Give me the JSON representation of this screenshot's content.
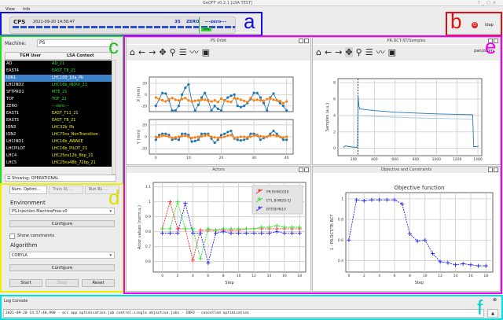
{
  "window": {
    "title": "GeOFF v0.2.1 [LSA TEST]",
    "controls": [
      "?",
      "_",
      "□",
      "×"
    ]
  },
  "menu": [
    "View",
    "Info"
  ],
  "timing": {
    "machine": "CPS",
    "timestamp": "2021-09-20 14:56:47",
    "cycle_number": "35",
    "user": "ZERO",
    "context": "---zero---",
    "indicator": "zero"
  },
  "login": {
    "label": "ldap",
    "icon": "power-icon",
    "color": "#e02020"
  },
  "annotations": {
    "a": "a",
    "b": "b",
    "c": "c",
    "d": "d",
    "e": "e",
    "f": "f"
  },
  "annotation_colors": {
    "a": "#1010e0",
    "b": "#e01010",
    "c": "#20e020",
    "d": "#f0f000",
    "e": "#f000f0",
    "f": "#00e0e0"
  },
  "selector": {
    "machine_label": "Machine:",
    "machine_value": "PS",
    "columns": [
      "TGM User",
      "LSA Context"
    ],
    "rows": [
      {
        "user": "AD",
        "context": "AD_21",
        "color": "#30e030"
      },
      {
        "user": "EAST4",
        "context": "EAST_T8_21",
        "color": "#30e030"
      },
      {
        "user": "ION1",
        "context": "LHC100_10a_Pb",
        "color": "#ffffff",
        "selected": true
      },
      {
        "user": "LHCIND2",
        "context": "LHC16b_INDIV_21",
        "color": "#30e030"
      },
      {
        "user": "SFTPRO1",
        "context": "MTE_21",
        "color": "#30e030"
      },
      {
        "user": "TOF",
        "context": "TOF_21",
        "color": "#30e030"
      },
      {
        "user": "ZERO",
        "context": "---zero---",
        "color": "#30e030"
      },
      {
        "user": "EAST1",
        "context": "EAST_T11_21",
        "color": "#f0f020"
      },
      {
        "user": "EAST3",
        "context": "EAST_T8_21",
        "color": "#f0f020"
      },
      {
        "user": "ION3",
        "context": "LHC32b_Pb",
        "color": "#f0f020"
      },
      {
        "user": "ION2",
        "context": "LHC75ns_NonTransition",
        "color": "#f0f020"
      },
      {
        "user": "LHCIND1",
        "context": "LHC16b_AWAKE",
        "color": "#f0f020"
      },
      {
        "user": "LHCPILOT",
        "context": "LHC16b_PILOT_21",
        "color": "#f0f020"
      },
      {
        "user": "LHC4",
        "context": "LHC25ns12b_8bp_21",
        "color": "#f0f020"
      },
      {
        "user": "LHC5",
        "context": "LHC25ns48b_72bp_21",
        "color": "#f0f020"
      }
    ],
    "showing": "Showing: OPERATIONAL"
  },
  "controls": {
    "tabs": [
      "Num. Optimi...",
      "Train RL ...",
      "Run RL ..."
    ],
    "environment_label": "Environment",
    "environment_value": "PS-Injection-MachineFree-v0",
    "configure": "Configure",
    "show_constraints": "Show constraints",
    "algorithm_label": "Algorithm",
    "algorithm_value": "COBYLA",
    "start": "Start",
    "stop": "Stop",
    "reset": "Reset"
  },
  "panels": {
    "orbit": "PS Orbit",
    "samples": "PR.DCT-ST/Samples",
    "actors": "Actors",
    "objective": "Objective and Constraints",
    "pan_zoom": "pan/zoom"
  },
  "log": {
    "title": "Log Console",
    "line": "2021-09-20 14:57:48,990 - acc app optimisation.job control.single objective.jobs - INFO - cancelled optimization"
  },
  "chart_data": [
    {
      "type": "line",
      "title": "",
      "xlabel": "",
      "ylabel": "X (mm)",
      "xlim": [
        -2,
        42
      ],
      "ylim": [
        -30,
        31
      ],
      "yticks": [
        20,
        0,
        -20
      ],
      "xticks": [
        0,
        10,
        20,
        30,
        40
      ],
      "grid": true,
      "x": [
        0,
        1,
        2,
        3,
        4,
        5,
        6,
        7,
        8,
        9,
        10,
        11,
        12,
        13,
        14,
        15,
        16,
        17,
        18,
        19,
        20,
        21,
        22,
        23,
        24,
        25,
        26,
        27,
        28,
        29,
        30,
        31,
        32,
        33,
        34,
        35,
        36,
        37,
        38,
        39,
        40
      ],
      "series": [
        {
          "color": "#1f77b4",
          "values": [
            -20,
            -8,
            3,
            2,
            -10,
            -28,
            -28,
            -20,
            0,
            12,
            18,
            -12,
            -28,
            -18,
            -5,
            3,
            -10,
            -28,
            -20,
            -25,
            -28,
            -10,
            -5,
            -2,
            0,
            -20,
            -22,
            -20,
            -15,
            -8,
            3,
            3,
            -5,
            -15,
            -28,
            -5,
            2,
            -10,
            -15,
            -20,
            -28
          ]
        },
        {
          "color": "#ff7f0e",
          "values": [
            -5,
            -8,
            -10,
            -12,
            -8,
            -6,
            -9,
            -10,
            -8,
            -6,
            -10,
            -12,
            -11,
            -10,
            -9,
            -9,
            -11,
            -12,
            -10,
            -13,
            -7,
            -10,
            -12,
            -13,
            -6,
            -7,
            -9,
            -11,
            -13,
            -6,
            -10,
            -9,
            -10,
            -11,
            -8,
            -7,
            -9,
            -10,
            -11,
            -15,
            -12
          ]
        }
      ]
    },
    {
      "type": "line",
      "title": "",
      "xlabel": "",
      "ylabel": "Y (mm)",
      "xlim": [
        -2,
        42
      ],
      "ylim": [
        -29,
        29
      ],
      "yticks": [
        20,
        0,
        -20
      ],
      "xticks": [
        0,
        10,
        20,
        30,
        40
      ],
      "grid": true,
      "x": [
        0,
        1,
        2,
        3,
        4,
        5,
        6,
        7,
        8,
        9,
        10,
        11,
        12,
        13,
        14,
        15,
        16,
        17,
        18,
        19,
        20,
        21,
        22,
        23,
        24,
        25,
        26,
        27,
        28,
        29,
        30,
        31,
        32,
        33,
        34,
        35,
        36,
        37,
        38,
        39,
        40
      ],
      "series": [
        {
          "color": "#1f77b4",
          "values": [
            -5,
            3,
            5,
            5,
            3,
            -5,
            -3,
            -5,
            5,
            5,
            3,
            -8,
            -7,
            -5,
            5,
            5,
            5,
            -3,
            -10,
            -5,
            3,
            5,
            8,
            10,
            -3,
            -5,
            -6,
            -5,
            -3,
            5,
            5,
            3,
            -5,
            -2,
            0,
            5,
            10,
            5,
            0,
            -5,
            -5
          ]
        },
        {
          "color": "#ff7f0e",
          "values": [
            0,
            0,
            2,
            2,
            0,
            -2,
            -1,
            0,
            1,
            2,
            0,
            -2,
            -1,
            0,
            1,
            2,
            3,
            0,
            -1,
            -2,
            -1,
            0,
            2,
            3,
            -2,
            -1,
            0,
            0,
            -1,
            0,
            2,
            2,
            1,
            0,
            0,
            2,
            3,
            1,
            0,
            -1,
            0
          ]
        }
      ]
    },
    {
      "type": "line",
      "title": "",
      "xlabel": "",
      "ylabel": "Samples (a.u.)",
      "xlim": [
        48,
        1438
      ],
      "ylim": [
        -0.9,
        8.5
      ],
      "yticks": [
        0,
        2,
        4,
        6,
        8
      ],
      "xticks": [
        200,
        400,
        600,
        800,
        1000,
        1200,
        1400
      ],
      "grid": true,
      "vline": 242,
      "series": [
        {
          "color": "#1f77b4",
          "points": [
            [
              100,
              0.1
            ],
            [
              120,
              0.3
            ],
            [
              160,
              0.2
            ],
            [
              230,
              0.1
            ],
            [
              238,
              0.2
            ],
            [
              242,
              6.5
            ],
            [
              250,
              5.2
            ],
            [
              260,
              4.8
            ],
            [
              400,
              4.6
            ],
            [
              600,
              4.4
            ],
            [
              800,
              4.3
            ],
            [
              1000,
              4.2
            ],
            [
              1200,
              4.15
            ],
            [
              1350,
              4.1
            ],
            [
              1360,
              0.2
            ],
            [
              1390,
              0.2
            ],
            [
              1410,
              0.3
            ]
          ]
        },
        {
          "color": "#9ecae1",
          "points": [
            [
              242,
              4.0
            ],
            [
              400,
              3.9
            ],
            [
              600,
              3.8
            ],
            [
              800,
              3.7
            ],
            [
              1000,
              3.65
            ],
            [
              1200,
              3.6
            ],
            [
              1350,
              3.55
            ]
          ]
        }
      ]
    },
    {
      "type": "line",
      "title": "",
      "xlabel": "Step",
      "ylabel": "Actor values (norm.u.)",
      "xlim": [
        -1.2,
        18.8
      ],
      "ylim": [
        0.53,
        1.13
      ],
      "yticks": [
        0.6,
        0.7,
        0.8,
        0.9,
        1,
        1.1
      ],
      "xticks": [
        0,
        2,
        4,
        6,
        8,
        10,
        12,
        14,
        16,
        18
      ],
      "grid": true,
      "legend": "top-right",
      "x": [
        0,
        1,
        2,
        3,
        4,
        5,
        6,
        7,
        8,
        9,
        10,
        11,
        12,
        13,
        14,
        15,
        16,
        17,
        18
      ],
      "series": [
        {
          "name": "PR.RHN1020",
          "color": "#ff2020",
          "values": [
            0.82,
            1.0,
            0.82,
            0.82,
            0.61,
            0.81,
            0.81,
            0.81,
            0.81,
            0.81,
            0.81,
            0.82,
            0.82,
            0.82,
            0.82,
            0.82,
            0.82,
            0.82,
            0.82
          ]
        },
        {
          "name": "ETL.BHN20-EJ",
          "color": "#20e020",
          "values": [
            0.82,
            0.82,
            1.0,
            0.82,
            0.82,
            0.62,
            0.82,
            0.81,
            0.82,
            0.82,
            0.82,
            0.82,
            0.82,
            0.83,
            0.83,
            0.84,
            0.83,
            0.83,
            0.83
          ]
        },
        {
          "name": "BTP.BHN10",
          "color": "#2020ff",
          "values": [
            0.79,
            0.79,
            0.79,
            0.99,
            0.79,
            0.79,
            0.59,
            0.79,
            0.8,
            0.79,
            0.79,
            0.79,
            0.79,
            0.79,
            0.79,
            0.8,
            0.79,
            0.79,
            0.79
          ]
        }
      ]
    },
    {
      "type": "line",
      "title": "Objective function",
      "xlabel": "Step",
      "ylabel": "1 - PR.DCT/TE.BCT",
      "xlim": [
        -0.4,
        18.9
      ],
      "ylim": [
        0.29,
        1.06
      ],
      "yticks": [
        0.4,
        0.6,
        0.8,
        1
      ],
      "xticks": [
        0,
        2,
        4,
        6,
        8,
        10,
        12,
        14,
        16,
        18
      ],
      "grid": true,
      "x": [
        0,
        1,
        2,
        3,
        4,
        5,
        6,
        7,
        8,
        9,
        10,
        11,
        12,
        13,
        14,
        15,
        16,
        17,
        18
      ],
      "series": [
        {
          "color": "#2020ff",
          "values": [
            0.6,
            0.99,
            0.98,
            0.99,
            0.99,
            0.99,
            0.99,
            0.95,
            0.66,
            0.59,
            0.6,
            0.47,
            0.39,
            0.38,
            0.36,
            0.37,
            0.36,
            0.35,
            0.35
          ]
        }
      ]
    }
  ]
}
